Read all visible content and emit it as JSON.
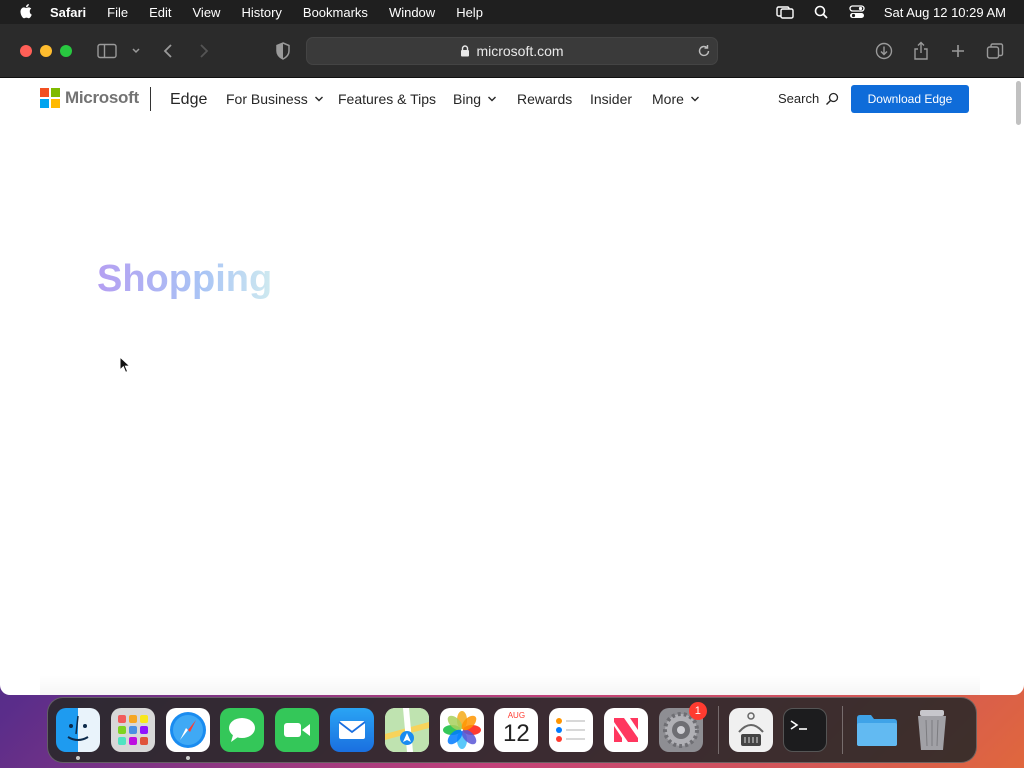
{
  "menubar": {
    "app_name": "Safari",
    "items": [
      "File",
      "Edit",
      "View",
      "History",
      "Bookmarks",
      "Window",
      "Help"
    ],
    "clock": "Sat Aug 12  10:29 AM"
  },
  "browser": {
    "url": "microsoft.com"
  },
  "site": {
    "brand": "Microsoft",
    "product": "Edge",
    "nav": [
      {
        "label": "For Business",
        "dropdown": true
      },
      {
        "label": "Features & Tips",
        "dropdown": false
      },
      {
        "label": "Bing",
        "dropdown": true
      },
      {
        "label": "Rewards",
        "dropdown": false
      },
      {
        "label": "Insider",
        "dropdown": false
      },
      {
        "label": "More",
        "dropdown": true
      }
    ],
    "search_label": "Search",
    "download_label": "Download Edge",
    "hero_word": "Shopping"
  },
  "dock": {
    "apps": [
      "Finder",
      "Launchpad",
      "Safari",
      "Messages",
      "FaceTime",
      "Mail",
      "Maps",
      "Photos",
      "Calendar",
      "Reminders",
      "News",
      "System Settings",
      "Archive Utility",
      "Terminal",
      "Folder",
      "Trash"
    ],
    "calendar": {
      "month": "AUG",
      "day": "12"
    },
    "settings_badge": "1"
  },
  "colors": {
    "download_button": "#0f6cd9",
    "ms_red": "#f25022",
    "ms_green": "#7fba00",
    "ms_blue": "#00a4ef",
    "ms_yellow": "#ffb900"
  }
}
